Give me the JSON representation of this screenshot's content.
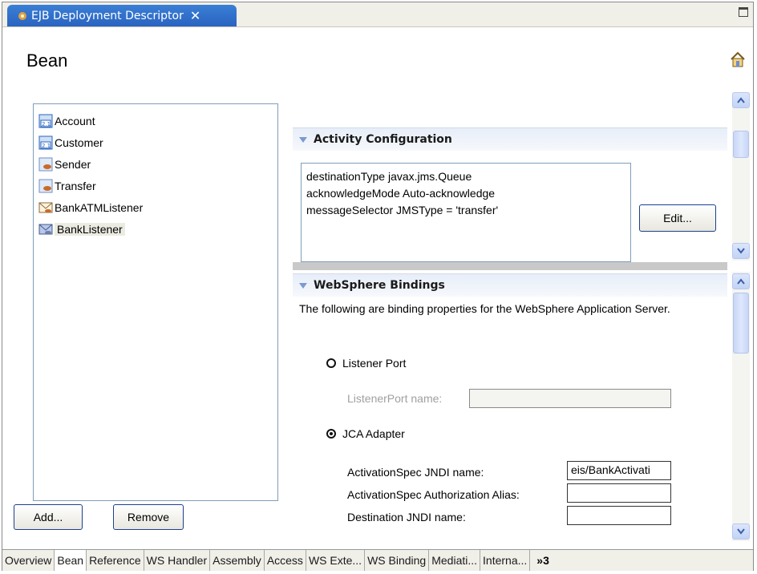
{
  "editor_tab": {
    "title": "EJB Deployment Descriptor",
    "close_icon": "close-icon"
  },
  "page": {
    "title": "Bean"
  },
  "tree": {
    "items": [
      {
        "label": "Account",
        "icon": "entity-bean-icon"
      },
      {
        "label": "Customer",
        "icon": "entity-bean-icon"
      },
      {
        "label": "Sender",
        "icon": "session-bean-icon"
      },
      {
        "label": "Transfer",
        "icon": "session-bean-icon"
      },
      {
        "label": "BankATMListener",
        "icon": "message-bean-icon"
      },
      {
        "label": "BankListener",
        "icon": "message-bean-icon",
        "selected": true
      }
    ]
  },
  "buttons": {
    "add": "Add...",
    "remove": "Remove",
    "edit": "Edit..."
  },
  "activity": {
    "title": "Activity Configuration",
    "lines": [
      "destinationType javax.jms.Queue",
      "acknowledgeMode Auto-acknowledge",
      "messageSelector JMSType = 'transfer'"
    ]
  },
  "bindings": {
    "title": "WebSphere Bindings",
    "description": "The following are binding properties for the WebSphere Application Server.",
    "listener_port_label": "Listener Port",
    "listener_port_name_label": "ListenerPort name:",
    "listener_port_name_value": "",
    "jca_adapter_label": "JCA Adapter",
    "selected_option": "JCA Adapter",
    "activation_spec_jndi_label": "ActivationSpec JNDI name:",
    "activation_spec_jndi_value": "eis/BankActivati",
    "activation_spec_alias_label": "ActivationSpec Authorization Alias:",
    "activation_spec_alias_value": "",
    "destination_jndi_label": "Destination JNDI name:",
    "destination_jndi_value": ""
  },
  "bottom_tabs": {
    "items": [
      "Overview",
      "Bean",
      "Reference",
      "WS Handler",
      "Assembly",
      "Access",
      "WS Exte...",
      "WS Binding",
      "Mediati...",
      "Interna..."
    ],
    "active": "Bean",
    "overflow": "»3"
  },
  "colors": {
    "tab_active": "#2a64c0",
    "section_header": "#e7eef8",
    "accent": "#7b9ad0"
  }
}
